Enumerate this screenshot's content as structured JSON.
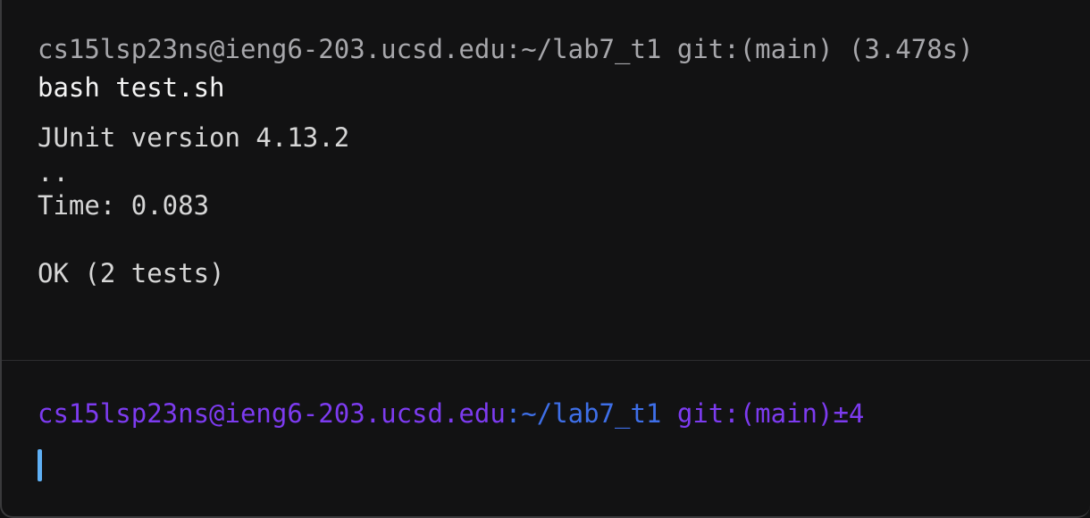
{
  "block": {
    "header": {
      "user_host": "cs15lsp23ns@ieng6-203.ucsd.edu",
      "path": ":~/lab7_t1",
      "git": " git:(main)",
      "duration": " (3.478s)"
    },
    "command": "bash test.sh",
    "output": {
      "line1": "JUnit version 4.13.2",
      "line2": "..",
      "line3": "Time: 0.083",
      "line4": "OK (2 tests)"
    }
  },
  "prompt": {
    "user_host": "cs15lsp23ns@ieng6-203.ucsd.edu",
    "path": ":~/lab7_t1",
    "git": " git:(main)±4"
  },
  "colors": {
    "background": "#121213",
    "prompt_user": "#7d3bf0",
    "prompt_path": "#3e6fe8",
    "cursor": "#5fb0f5"
  }
}
